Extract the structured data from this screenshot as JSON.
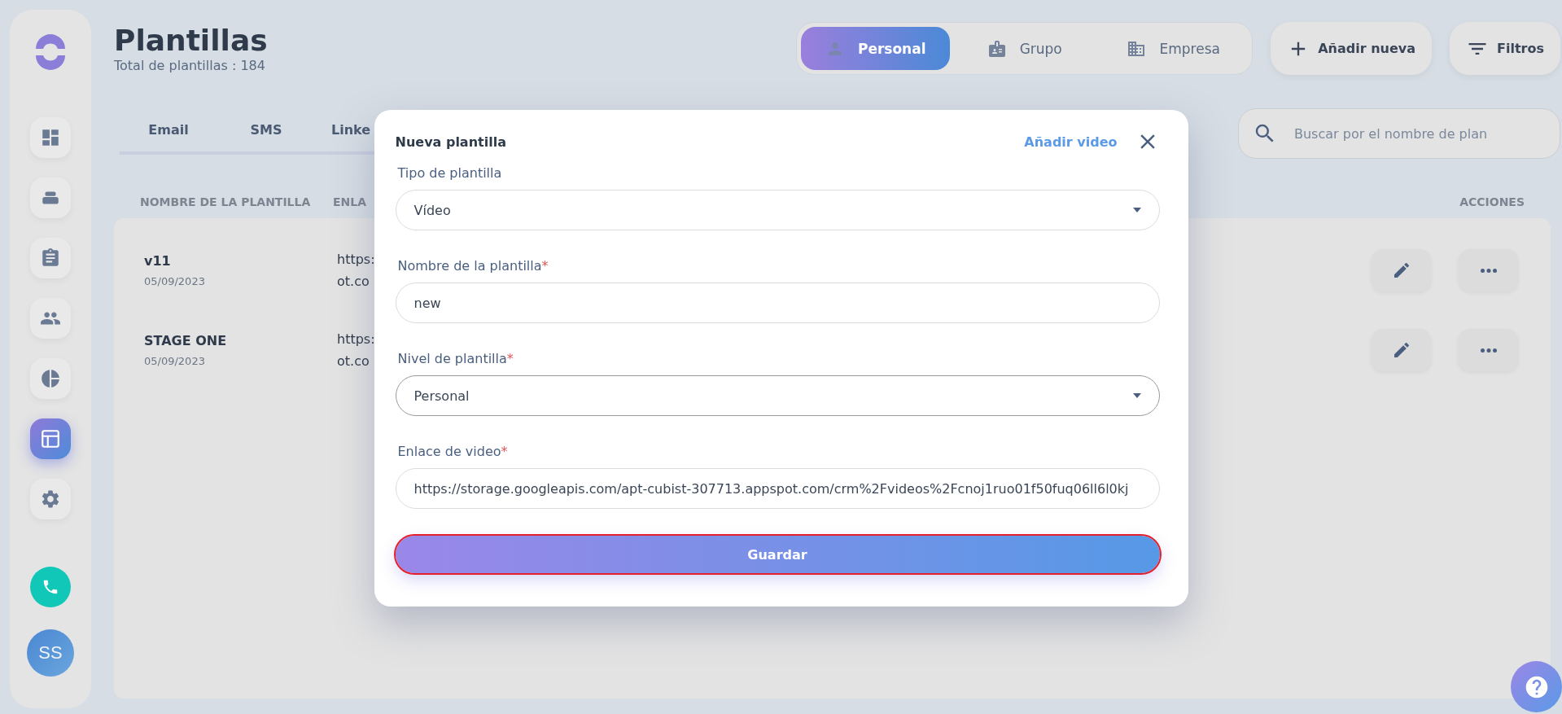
{
  "sidebar": {
    "items": [
      {
        "selected": false
      },
      {
        "selected": false
      },
      {
        "selected": false
      },
      {
        "selected": false
      },
      {
        "selected": false
      },
      {
        "selected": true
      },
      {
        "selected": false
      }
    ],
    "avatar": "SS"
  },
  "header": {
    "title": "Plantillas",
    "subtitle": "Total de plantillas : 184"
  },
  "scope_tabs": [
    {
      "label": "Personal",
      "selected": true
    },
    {
      "label": "Grupo",
      "selected": false
    },
    {
      "label": "Empresa",
      "selected": false
    }
  ],
  "buttons": [
    "Añadir nueva",
    "Filtros"
  ],
  "tabs": [
    "Email",
    "SMS",
    "Linke"
  ],
  "search": {
    "placeholder": "Buscar por el nombre de plan"
  },
  "table": {
    "columns": [
      "NOMBRE DE LA PLANTILLA",
      "ENLA",
      "ACCIONES"
    ],
    "rows": [
      {
        "name": "v11",
        "date": "05/09/2023",
        "link": [
          "https:",
          "ot.co"
        ]
      },
      {
        "name": "STAGE ONE",
        "date": "05/09/2023",
        "link": [
          "https:",
          "ot.co"
        ]
      }
    ]
  },
  "modal": {
    "title": "Nueva plantilla",
    "link": "Añadir video",
    "fields": [
      {
        "kind": "select",
        "label": "Tipo de plantilla",
        "value": "Vídeo",
        "focused": false
      },
      {
        "kind": "text",
        "label": "Nombre de la plantilla",
        "required_mark": "*",
        "value": "new",
        "focused": false
      },
      {
        "kind": "select",
        "label": "Nivel de plantilla",
        "required_mark": "*",
        "value": "Personal",
        "focused": true
      },
      {
        "kind": "text",
        "label": "Enlace de video",
        "required_mark": "*",
        "value": "https://storage.googleapis.com/apt-cubist-307713.appspot.com/crm%2Fvideos%2Fcnoj1ruo01f50fuq06ll6l0kj",
        "focused": false
      }
    ],
    "submit": {
      "label": "Guardar",
      "focused": true
    }
  }
}
